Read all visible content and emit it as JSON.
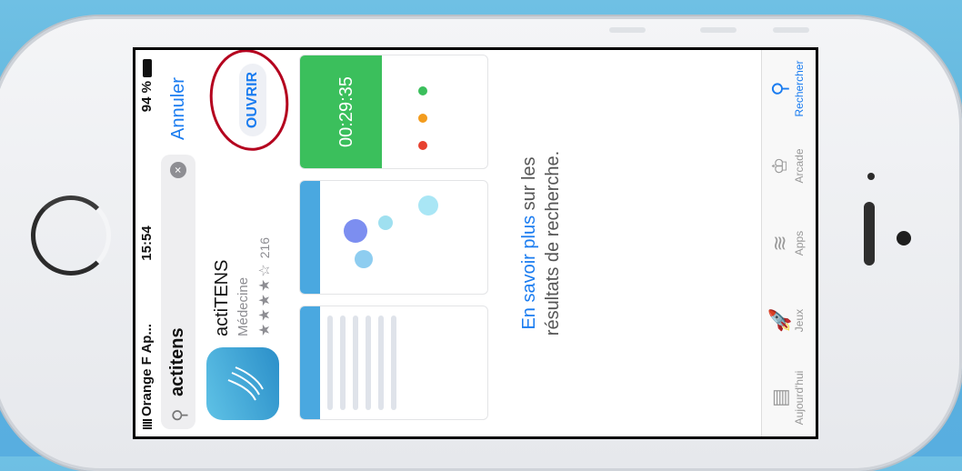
{
  "status": {
    "carrier": "Orange F Ap...",
    "time": "15:54",
    "battery": "94 %"
  },
  "search": {
    "query": "actitens",
    "cancel_label": "Annuler"
  },
  "result": {
    "name": "actiTENS",
    "category": "Médecine",
    "stars": "★★★★☆",
    "rating_count": "216",
    "open_label": "OUVRIR",
    "screenshot_timer": "00:29:35"
  },
  "more_results": {
    "link": "En savoir plus",
    "rest": " sur les",
    "line2": "résultats de recherche."
  },
  "tabs": [
    {
      "label": "Aujourd'hui",
      "icon": "today-icon"
    },
    {
      "label": "Jeux",
      "icon": "rocket-icon"
    },
    {
      "label": "Apps",
      "icon": "apps-stack-icon"
    },
    {
      "label": "Arcade",
      "icon": "arcade-icon"
    },
    {
      "label": "Rechercher",
      "icon": "search-icon"
    }
  ],
  "colors": {
    "accent": "#1a7cf0",
    "annotation": "#b4001e",
    "device_bg": "#5fb4dc"
  }
}
